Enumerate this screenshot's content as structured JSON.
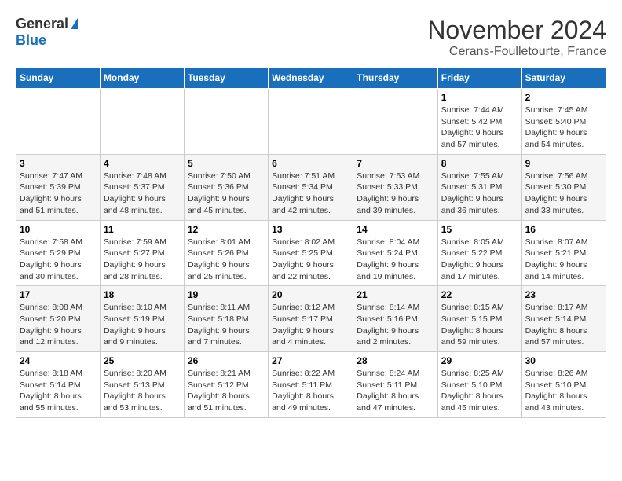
{
  "logo": {
    "general": "General",
    "blue": "Blue"
  },
  "title": "November 2024",
  "subtitle": "Cerans-Foulletourte, France",
  "days_header": [
    "Sunday",
    "Monday",
    "Tuesday",
    "Wednesday",
    "Thursday",
    "Friday",
    "Saturday"
  ],
  "weeks": [
    [
      {
        "day": "",
        "info": ""
      },
      {
        "day": "",
        "info": ""
      },
      {
        "day": "",
        "info": ""
      },
      {
        "day": "",
        "info": ""
      },
      {
        "day": "",
        "info": ""
      },
      {
        "day": "1",
        "info": "Sunrise: 7:44 AM\nSunset: 5:42 PM\nDaylight: 9 hours and 57 minutes."
      },
      {
        "day": "2",
        "info": "Sunrise: 7:45 AM\nSunset: 5:40 PM\nDaylight: 9 hours and 54 minutes."
      }
    ],
    [
      {
        "day": "3",
        "info": "Sunrise: 7:47 AM\nSunset: 5:39 PM\nDaylight: 9 hours and 51 minutes."
      },
      {
        "day": "4",
        "info": "Sunrise: 7:48 AM\nSunset: 5:37 PM\nDaylight: 9 hours and 48 minutes."
      },
      {
        "day": "5",
        "info": "Sunrise: 7:50 AM\nSunset: 5:36 PM\nDaylight: 9 hours and 45 minutes."
      },
      {
        "day": "6",
        "info": "Sunrise: 7:51 AM\nSunset: 5:34 PM\nDaylight: 9 hours and 42 minutes."
      },
      {
        "day": "7",
        "info": "Sunrise: 7:53 AM\nSunset: 5:33 PM\nDaylight: 9 hours and 39 minutes."
      },
      {
        "day": "8",
        "info": "Sunrise: 7:55 AM\nSunset: 5:31 PM\nDaylight: 9 hours and 36 minutes."
      },
      {
        "day": "9",
        "info": "Sunrise: 7:56 AM\nSunset: 5:30 PM\nDaylight: 9 hours and 33 minutes."
      }
    ],
    [
      {
        "day": "10",
        "info": "Sunrise: 7:58 AM\nSunset: 5:29 PM\nDaylight: 9 hours and 30 minutes."
      },
      {
        "day": "11",
        "info": "Sunrise: 7:59 AM\nSunset: 5:27 PM\nDaylight: 9 hours and 28 minutes."
      },
      {
        "day": "12",
        "info": "Sunrise: 8:01 AM\nSunset: 5:26 PM\nDaylight: 9 hours and 25 minutes."
      },
      {
        "day": "13",
        "info": "Sunrise: 8:02 AM\nSunset: 5:25 PM\nDaylight: 9 hours and 22 minutes."
      },
      {
        "day": "14",
        "info": "Sunrise: 8:04 AM\nSunset: 5:24 PM\nDaylight: 9 hours and 19 minutes."
      },
      {
        "day": "15",
        "info": "Sunrise: 8:05 AM\nSunset: 5:22 PM\nDaylight: 9 hours and 17 minutes."
      },
      {
        "day": "16",
        "info": "Sunrise: 8:07 AM\nSunset: 5:21 PM\nDaylight: 9 hours and 14 minutes."
      }
    ],
    [
      {
        "day": "17",
        "info": "Sunrise: 8:08 AM\nSunset: 5:20 PM\nDaylight: 9 hours and 12 minutes."
      },
      {
        "day": "18",
        "info": "Sunrise: 8:10 AM\nSunset: 5:19 PM\nDaylight: 9 hours and 9 minutes."
      },
      {
        "day": "19",
        "info": "Sunrise: 8:11 AM\nSunset: 5:18 PM\nDaylight: 9 hours and 7 minutes."
      },
      {
        "day": "20",
        "info": "Sunrise: 8:12 AM\nSunset: 5:17 PM\nDaylight: 9 hours and 4 minutes."
      },
      {
        "day": "21",
        "info": "Sunrise: 8:14 AM\nSunset: 5:16 PM\nDaylight: 9 hours and 2 minutes."
      },
      {
        "day": "22",
        "info": "Sunrise: 8:15 AM\nSunset: 5:15 PM\nDaylight: 8 hours and 59 minutes."
      },
      {
        "day": "23",
        "info": "Sunrise: 8:17 AM\nSunset: 5:14 PM\nDaylight: 8 hours and 57 minutes."
      }
    ],
    [
      {
        "day": "24",
        "info": "Sunrise: 8:18 AM\nSunset: 5:14 PM\nDaylight: 8 hours and 55 minutes."
      },
      {
        "day": "25",
        "info": "Sunrise: 8:20 AM\nSunset: 5:13 PM\nDaylight: 8 hours and 53 minutes."
      },
      {
        "day": "26",
        "info": "Sunrise: 8:21 AM\nSunset: 5:12 PM\nDaylight: 8 hours and 51 minutes."
      },
      {
        "day": "27",
        "info": "Sunrise: 8:22 AM\nSunset: 5:11 PM\nDaylight: 8 hours and 49 minutes."
      },
      {
        "day": "28",
        "info": "Sunrise: 8:24 AM\nSunset: 5:11 PM\nDaylight: 8 hours and 47 minutes."
      },
      {
        "day": "29",
        "info": "Sunrise: 8:25 AM\nSunset: 5:10 PM\nDaylight: 8 hours and 45 minutes."
      },
      {
        "day": "30",
        "info": "Sunrise: 8:26 AM\nSunset: 5:10 PM\nDaylight: 8 hours and 43 minutes."
      }
    ]
  ]
}
